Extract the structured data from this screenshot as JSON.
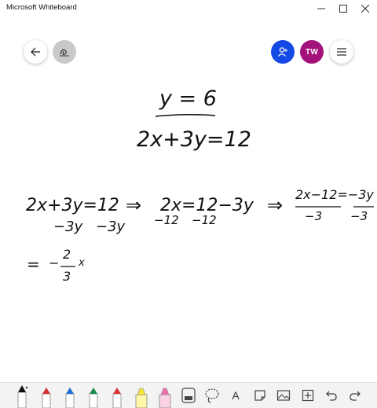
{
  "window": {
    "title": "Microsoft Whiteboard",
    "controls": [
      "minimize",
      "maximize",
      "close"
    ]
  },
  "header": {
    "avatar_initials": "TW",
    "colors": {
      "share": "#1549e6",
      "avatar": "#a3127b",
      "ink_toggle": "#c9c9c9"
    }
  },
  "canvas": {
    "ink_line_1": "y = 6",
    "ink_line_2": "2x+3y=12",
    "ink_step_1": "2x+3y=12",
    "ink_arrow_1": "⇒",
    "ink_step_2": "2x=12−3y",
    "ink_arrow_2": "⇒",
    "ink_frac_num": "2x−12=−3y",
    "ink_frac_den_left": "−3",
    "ink_frac_den_right": "−3",
    "ink_sub_1": "−3y",
    "ink_sub_2": "−3y",
    "ink_sub_3": "−12",
    "ink_sub_4": "−12",
    "ink_result_eq": "=",
    "ink_result_num": "2",
    "ink_result_den": "3",
    "ink_result_x": "x",
    "ink_result_minus": "−"
  },
  "toolbar": {
    "tools": [
      {
        "name": "pen-black",
        "color": "#111111"
      },
      {
        "name": "pen-red",
        "color": "#d23030"
      },
      {
        "name": "pen-blue",
        "color": "#1f6fd6"
      },
      {
        "name": "pen-green",
        "color": "#1a8a4a"
      },
      {
        "name": "pen-red-2",
        "color": "#d93636"
      },
      {
        "name": "highlighter-yellow",
        "color": "#f4e43a"
      },
      {
        "name": "highlighter-pink",
        "color": "#ef6fae"
      },
      {
        "name": "eraser-icon"
      },
      {
        "name": "lasso-icon"
      },
      {
        "name": "text-icon",
        "label": "A"
      },
      {
        "name": "sticky-note-icon"
      },
      {
        "name": "image-icon"
      },
      {
        "name": "add-icon"
      },
      {
        "name": "undo-icon"
      },
      {
        "name": "redo-icon"
      }
    ]
  }
}
